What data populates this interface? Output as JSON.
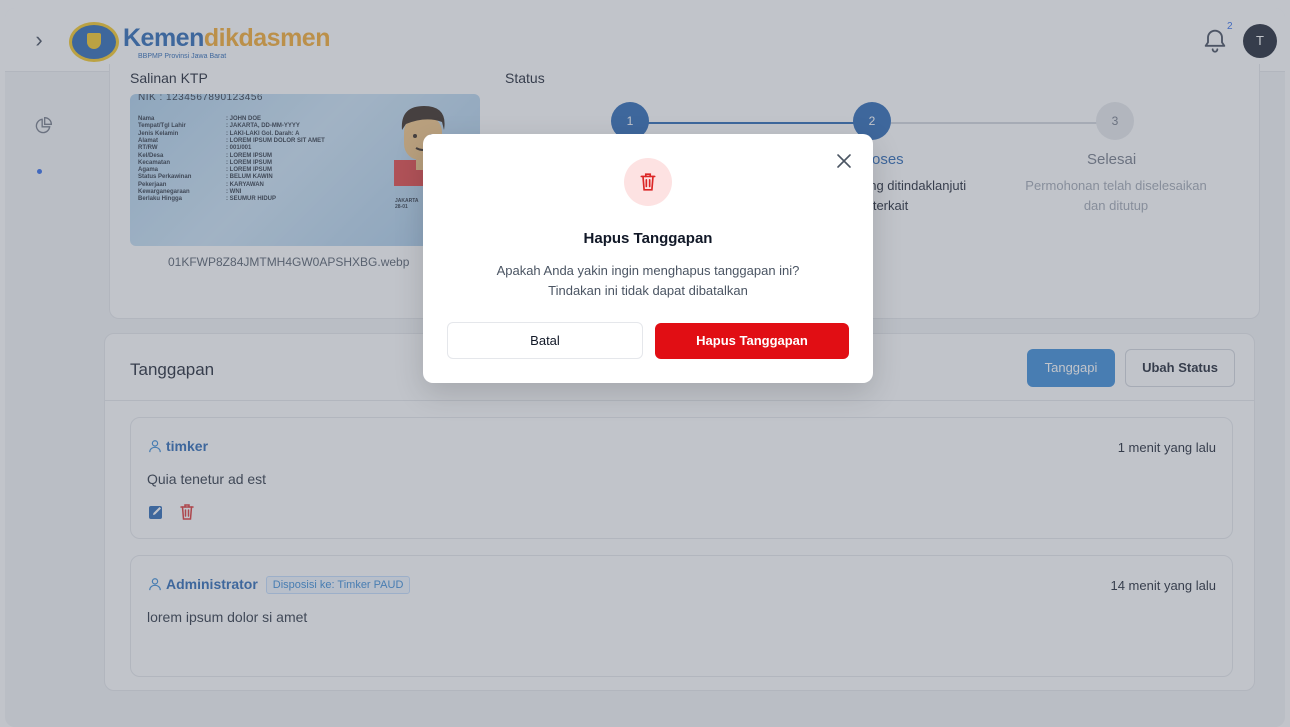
{
  "header": {
    "brand_part1": "Kemen",
    "brand_part2": "dikdasmen",
    "brand_subtitle": "BBPMP Provinsi Jawa Barat",
    "notification_count": "2",
    "avatar_initial": "T"
  },
  "detail": {
    "ktp_label": "Salinan KTP",
    "status_label": "Status",
    "ktp_file": "01KFWP8Z84JMTMH4GW0APSHXBG.webp",
    "ktp_card": {
      "nik": "NIK   :   1234567890123456",
      "rows": [
        {
          "k": "Nama",
          "v": ": JOHN DOE"
        },
        {
          "k": "Tempat/Tgl Lahir",
          "v": ": JAKARTA, DD-MM-YYYY"
        },
        {
          "k": "Jenis Kelamin",
          "v": ": LAKI-LAKI      Gol. Darah: A"
        },
        {
          "k": "Alamat",
          "v": ": LOREM IPSUM DOLOR SIT AMET"
        },
        {
          "k": "      RT/RW",
          "v": ": 001/001"
        },
        {
          "k": "      Kel/Desa",
          "v": ": LOREM IPSUM"
        },
        {
          "k": "      Kecamatan",
          "v": ": LOREM IPSUM"
        },
        {
          "k": "Agama",
          "v": ": LOREM IPSUM"
        },
        {
          "k": "Status Perkawinan",
          "v": ": BELUM KAWIN"
        },
        {
          "k": "Pekerjaan",
          "v": ": KARYAWAN"
        },
        {
          "k": "Kewarganegaraan",
          "v": ": WNI"
        },
        {
          "k": "Berlaku Hingga",
          "v": ": SEUMUR HIDUP"
        }
      ],
      "city": "JAKARTA",
      "date": "28-01"
    },
    "steps": [
      {
        "number": "1",
        "state": "active"
      },
      {
        "number": "2",
        "state": "active",
        "title": "oses",
        "desc_line1": "ang ditindaklanjuti",
        "desc_line2": "n terkait"
      },
      {
        "number": "3",
        "state": "inactive",
        "title": "Selesai",
        "desc_line1": "Permohonan telah diselesaikan",
        "desc_line2": "dan ditutup"
      }
    ]
  },
  "responses_panel": {
    "title": "Tanggapan",
    "reply_button": "Tanggapi",
    "change_status_button": "Ubah Status",
    "items": [
      {
        "user": "timker",
        "time": "1 menit yang lalu",
        "text": "Quia tenetur ad est"
      },
      {
        "user": "Administrator",
        "badge": "Disposisi ke: Timker PAUD",
        "time": "14 menit yang lalu",
        "text": "lorem ipsum dolor si amet"
      }
    ]
  },
  "modal": {
    "title": "Hapus Tanggapan",
    "message_line1": "Apakah Anda yakin ingin menghapus tanggapan ini?",
    "message_line2": "Tindakan ini tidak dapat dibatalkan",
    "cancel_button": "Batal",
    "confirm_button": "Hapus Tanggapan"
  },
  "colors": {
    "brand_blue": "#1e5fb0",
    "brand_orange": "#f5a623",
    "primary_button": "#2f86d6",
    "danger": "#e10e14"
  }
}
